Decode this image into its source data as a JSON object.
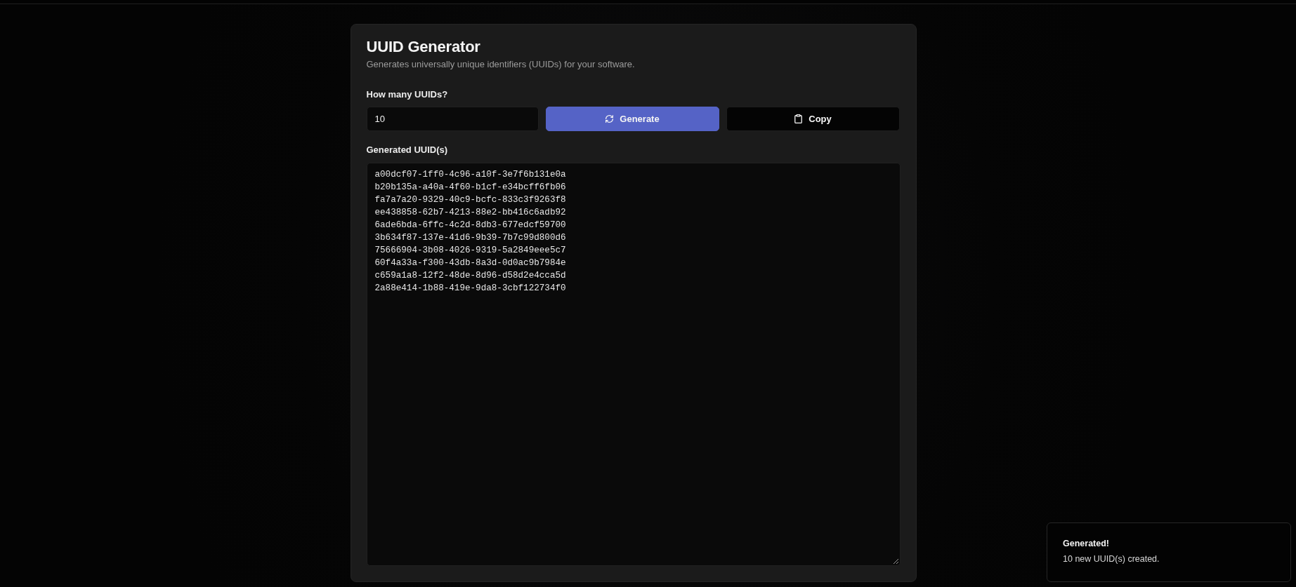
{
  "tool": {
    "title": "UUID Generator",
    "description": "Generates universally unique identifiers (UUIDs) for your software."
  },
  "count_field": {
    "label": "How many UUIDs?",
    "value": "10"
  },
  "buttons": [
    {
      "kind": "generate",
      "label": "Generate"
    },
    {
      "kind": "copy",
      "label": "Copy"
    }
  ],
  "output": {
    "label": "Generated UUID(s)",
    "lines": [
      "a00dcf07-1ff0-4c96-a10f-3e7f6b131e0a",
      "b20b135a-a40a-4f60-b1cf-e34bcff6fb06",
      "fa7a7a20-9329-40c9-bcfc-833c3f9263f8",
      "ee438858-62b7-4213-88e2-bb416c6adb92",
      "6ade6bda-6ffc-4c2d-8db3-677edcf59700",
      "3b634f87-137e-41d6-9b39-7b7c99d800d6",
      "75666904-3b08-4026-9319-5a2849eee5c7",
      "60f4a33a-f300-43db-8a3d-0d0ac9b7984e",
      "c659a1a8-12f2-48de-8d96-d58d2e4cca5d",
      "2a88e414-1b88-419e-9da8-3cbf122734f0"
    ]
  },
  "toast": {
    "title": "Generated!",
    "message": "10 new UUID(s) created."
  }
}
